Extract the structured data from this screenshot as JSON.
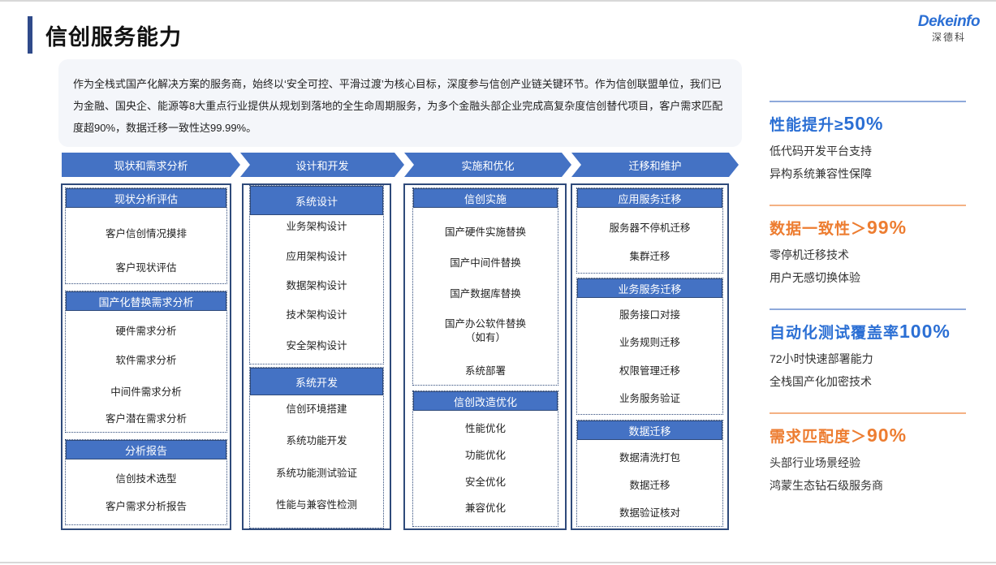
{
  "page": {
    "title": "信创服务能力",
    "logo_en": "Dekeinfo",
    "logo_cn": "深德科",
    "intro": "作为全栈式国产化解决方案的服务商，始终以‘安全可控、平滑过渡’为核心目标，深度参与信创产业链关键环节。作为信创联盟单位，我们已为金融、国央企、能源等8大重点行业提供从规划到落地的全生命周期服务，为多个金融头部企业完成高复杂度信创替代项目，客户需求匹配度超90%，数据迁移一致性达99.99%。"
  },
  "phases": [
    "现状和需求分析",
    "设计和开发",
    "实施和优化",
    "迁移和维护"
  ],
  "columns": [
    {
      "boxes": [
        {
          "title": "现状分析评估",
          "items": [
            "客户信创情况摸排",
            "客户现状评估"
          ]
        },
        {
          "title": "国产化替换需求分析",
          "items": [
            "硬件需求分析",
            "软件需求分析",
            "中间件需求分析",
            "客户潜在需求分析"
          ]
        },
        {
          "title": "分析报告",
          "items": [
            "信创技术选型",
            "客户需求分析报告"
          ]
        }
      ]
    },
    {
      "boxes": [
        {
          "title": "系统设计",
          "items": [
            "业务架构设计",
            "应用架构设计",
            "数据架构设计",
            "技术架构设计",
            "安全架构设计"
          ]
        },
        {
          "title": "系统开发",
          "items": [
            "信创环境搭建",
            "系统功能开发",
            "系统功能测试验证",
            "性能与兼容性检测"
          ]
        }
      ]
    },
    {
      "boxes": [
        {
          "title": "信创实施",
          "items": [
            "国产硬件实施替换",
            "国产中间件替换",
            "国产数据库替换",
            "国产办公软件替换",
            "（如有）",
            "系统部署"
          ]
        },
        {
          "title": "信创改造优化",
          "items": [
            "性能优化",
            "功能优化",
            "安全优化",
            "兼容优化"
          ]
        }
      ]
    },
    {
      "boxes": [
        {
          "title": "应用服务迁移",
          "items": [
            "服务器不停机迁移",
            "集群迁移"
          ]
        },
        {
          "title": "业务服务迁移",
          "items": [
            "服务接口对接",
            "业务规则迁移",
            "权限管理迁移",
            "业务服务验证"
          ]
        },
        {
          "title": "数据迁移",
          "items": [
            "数据清洗打包",
            "数据迁移",
            "数据验证核对"
          ]
        }
      ]
    }
  ],
  "stats": [
    {
      "label": "性能提升≥",
      "value": "50%",
      "color": "#2b6fd4",
      "lines": [
        "低代码开发平台支持",
        "异构系统兼容性保障"
      ]
    },
    {
      "label": "数据一致性＞",
      "value": "99%",
      "color": "#ed7d31",
      "lines": [
        "零停机迁移技术",
        "用户无感切换体验"
      ]
    },
    {
      "label": "自动化测试覆盖率",
      "value": "100%",
      "color": "#2b6fd4",
      "lines": [
        "72小时快速部署能力",
        "全栈国产化加密技术"
      ]
    },
    {
      "label": "需求匹配度＞",
      "value": "90%",
      "color": "#ed7d31",
      "lines": [
        "头部行业场景经验",
        "鸿蒙生态钻石级服务商"
      ]
    }
  ],
  "colors": {
    "accent_blue": "#4472c4",
    "dark_navy": "#2f4a7a",
    "title_bar": "#2f4a8a",
    "stat_blue": "#2b6fd4",
    "stat_orange": "#ed7d31",
    "intro_bg": "#f4f6fa"
  }
}
